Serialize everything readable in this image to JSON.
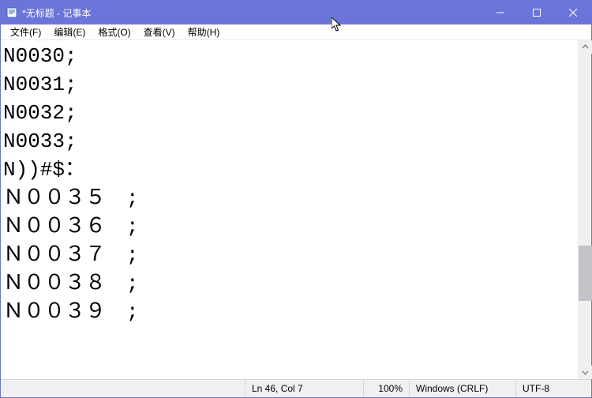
{
  "titlebar": {
    "title": "*无标题 - 记事本"
  },
  "menu": {
    "file": "文件(F)",
    "edit": "编辑(E)",
    "format": "格式(O)",
    "view": "查看(V)",
    "help": "帮助(H)"
  },
  "editor": {
    "content": "N0030;\nN0031;\nN0032;\nN0033;\nN))#$：\nＮ００３５　;\nＮ００３６　;\nＮ００３７　;\nＮ００３８　;\nＮ００３９　;"
  },
  "status": {
    "lncol": "Ln 46,  Col 7",
    "zoom": "100%",
    "eol": "Windows (CRLF)",
    "encoding": "UTF-8"
  }
}
